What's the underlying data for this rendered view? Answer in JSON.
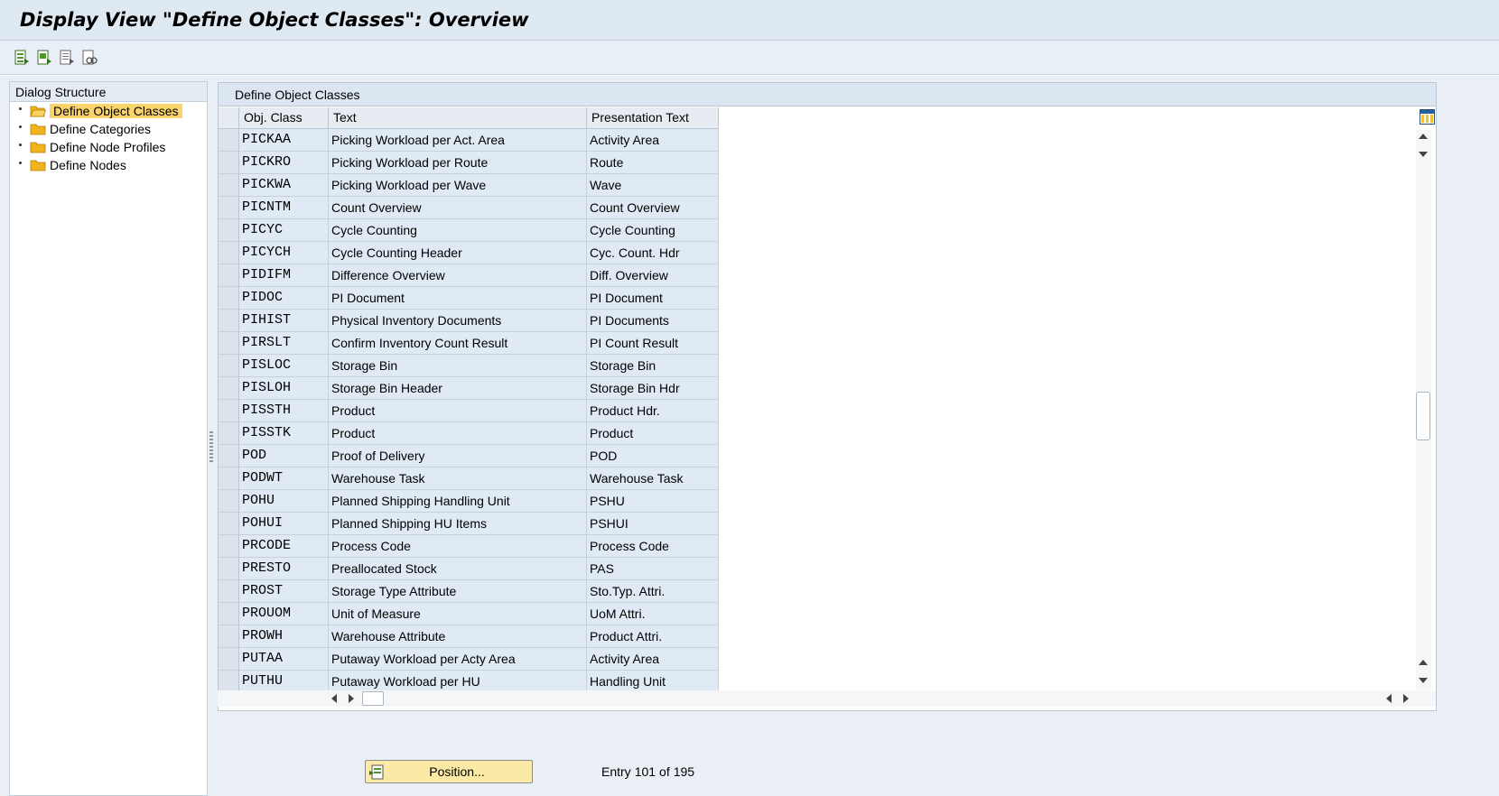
{
  "window": {
    "title": "Display View \"Define Object Classes\": Overview"
  },
  "toolbar": {
    "buttons": [
      {
        "name": "select-all-icon"
      },
      {
        "name": "select-block-icon"
      },
      {
        "name": "deselect-all-icon"
      },
      {
        "name": "find-icon"
      }
    ]
  },
  "dialog_structure": {
    "title": "Dialog Structure",
    "items": [
      {
        "label": "Define Object Classes",
        "selected": true
      },
      {
        "label": "Define Categories",
        "selected": false
      },
      {
        "label": "Define Node Profiles",
        "selected": false
      },
      {
        "label": "Define Nodes",
        "selected": false
      }
    ]
  },
  "table": {
    "title": "Define Object Classes",
    "columns": [
      "Obj. Class",
      "Text",
      "Presentation Text"
    ],
    "rows": [
      [
        "PICKAA",
        "Picking Workload per Act. Area",
        "Activity Area"
      ],
      [
        "PICKRO",
        "Picking Workload per Route",
        "Route"
      ],
      [
        "PICKWA",
        "Picking Workload per Wave",
        "Wave"
      ],
      [
        "PICNTM",
        "Count Overview",
        "Count Overview"
      ],
      [
        "PICYC",
        "Cycle Counting",
        "Cycle Counting"
      ],
      [
        "PICYCH",
        "Cycle Counting Header",
        "Cyc. Count. Hdr"
      ],
      [
        "PIDIFM",
        "Difference Overview",
        "Diff. Overview"
      ],
      [
        "PIDOC",
        "PI Document",
        "PI Document"
      ],
      [
        "PIHIST",
        "Physical Inventory Documents",
        "PI Documents"
      ],
      [
        "PIRSLT",
        "Confirm Inventory Count Result",
        "PI Count Result"
      ],
      [
        "PISLOC",
        "Storage Bin",
        "Storage Bin"
      ],
      [
        "PISLOH",
        "Storage Bin Header",
        "Storage Bin Hdr"
      ],
      [
        "PISSTH",
        "Product",
        "Product Hdr."
      ],
      [
        "PISSTK",
        "Product",
        "Product"
      ],
      [
        "POD",
        "Proof of Delivery",
        "POD"
      ],
      [
        "PODWT",
        "Warehouse Task",
        "Warehouse Task"
      ],
      [
        "POHU",
        "Planned Shipping Handling Unit",
        "PSHU"
      ],
      [
        "POHUI",
        "Planned Shipping HU Items",
        "PSHUI"
      ],
      [
        "PRCODE",
        "Process Code",
        "Process Code"
      ],
      [
        "PRESTO",
        "Preallocated Stock",
        "PAS"
      ],
      [
        "PROST",
        "Storage Type Attribute",
        "Sto.Typ. Attri."
      ],
      [
        "PROUOM",
        "Unit of Measure",
        "UoM Attri."
      ],
      [
        "PROWH",
        "Warehouse Attribute",
        "Product Attri."
      ],
      [
        "PUTAA",
        "Putaway Workload per Acty Area",
        "Activity Area"
      ],
      [
        "PUTHU",
        "Putaway Workload per HU",
        "Handling Unit"
      ]
    ]
  },
  "footer": {
    "position_button": "Position...",
    "entry_label": "Entry",
    "entry_current": "101",
    "entry_of": "of",
    "entry_total": "195"
  },
  "colors": {
    "selected_tree_item": "#f9d36b",
    "cell_background": "#dfeaf5",
    "title_bar": "#dfe9f2",
    "position_button": "#fbe9a6"
  }
}
